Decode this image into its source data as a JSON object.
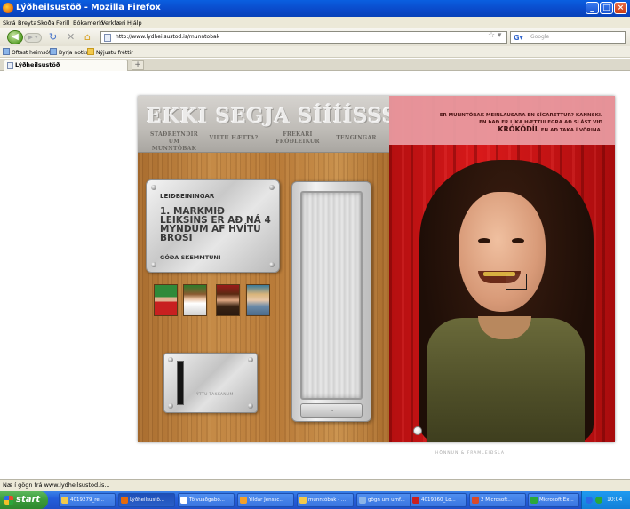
{
  "window": {
    "title": "Lýðheilsustöð - Mozilla Firefox"
  },
  "menu": [
    "Skrá",
    "Breyta",
    "Skoða",
    "Ferill",
    "Bókamerki",
    "Verkfæri",
    "Hjálp"
  ],
  "nav": {
    "url": "http://www.lydheilsustod.is/munntobak",
    "search_placeholder": "Google"
  },
  "bookmarks": [
    "Oftast heimsótt",
    "Byrja notkun",
    "Nýjustu fréttir"
  ],
  "tab": {
    "title": "Lýðheilsustöð",
    "new_tab": "+"
  },
  "app": {
    "logo": "EKKI SEGJA SÍÍÍÍSSS!",
    "nav": [
      {
        "line1": "STAÐREYNDIR",
        "line2": "UM MUNNTÓBAK"
      },
      {
        "line1": "VILTU HÆTTA?",
        "line2": ""
      },
      {
        "line1": "FREKARI",
        "line2": "FRÓÐLEIKUR"
      },
      {
        "line1": "TENGINGAR",
        "line2": ""
      }
    ],
    "instructions": {
      "heading": "LEIÐBEININGAR",
      "body": "1. MARKMIÐ LEIKSINS ER AÐ NÁ 4 MYNDUM AF HVÍTU BROSI",
      "footer": "GÓÐA SKEMMTUN!"
    },
    "slider_caption": "ÝTTU TAKKANUM",
    "tagline": {
      "line1": "ER MUNNTÓBAK MEINLAUSARA EN SÍGARETTUR? KANNSKI.",
      "line2": "EN ÞAÐ ER LÍKA HÆTTULEGRA AÐ SLÁST VIÐ",
      "line3_strong": "KRÓKÓDÍL",
      "line3_rest": " EN AÐ TAKA Í VÖRINA."
    },
    "credit": "HÖNNUN & FRAMLEIÐSLA"
  },
  "status": "Næ í gögn frá www.lydheilsustod.is...",
  "taskbar": {
    "start": "start",
    "tasks": [
      "4019279_re...",
      "Lýðheilsustö...",
      "Tölvuaðgabó...",
      "Yildar Jenssc...",
      "munntóbak - ...",
      "gögn um umf...",
      "4019360_Lo...",
      "2 Microsoft...",
      "Microsoft Ex..."
    ],
    "clock": "10:04"
  },
  "colors": {
    "titlebar": "#0a49c9",
    "wood": "#b87a38",
    "curtain": "#c41314",
    "taskbar": "#245edb"
  }
}
